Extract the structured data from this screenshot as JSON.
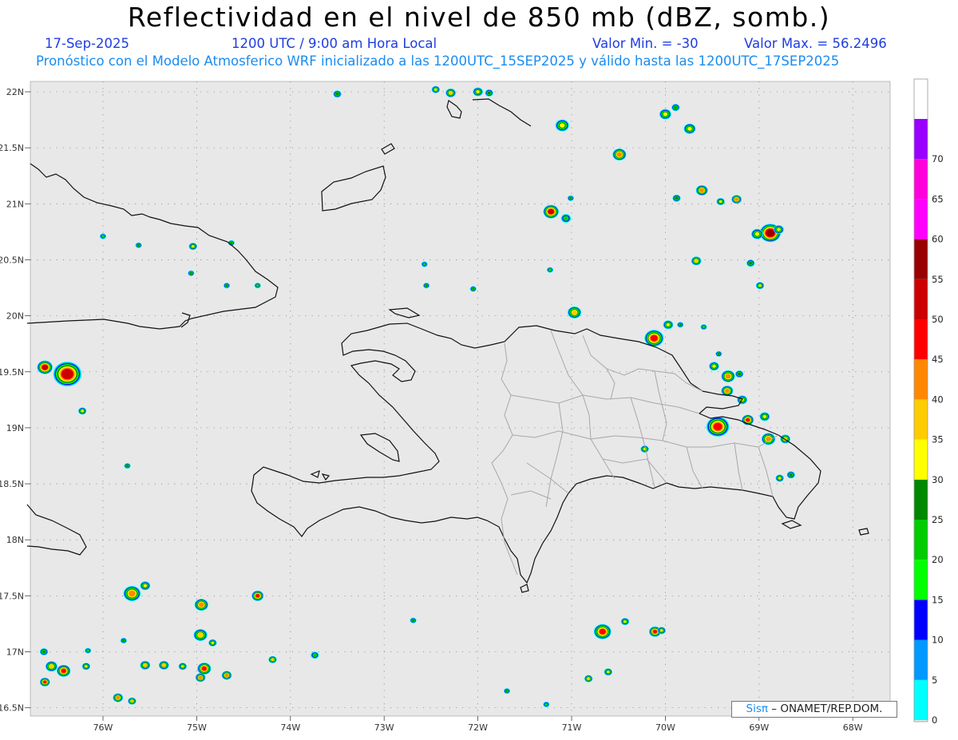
{
  "header": {
    "title": "Reflectividad en el nivel de 850 mb (dBZ, somb.)",
    "date": "17-Sep-2025",
    "time": "1200 UTC / 9:00 am Hora Local",
    "min_value": "Valor Min. = -30",
    "max_value": "Valor Max. = 56.2496",
    "forecast_info": "Pronóstico con el Modelo Atmosferico WRF inicializado a las 1200UTC_15SEP2025 y válido hasta las  1200UTC_17SEP2025"
  },
  "axes": {
    "lat_labels": [
      "22N",
      "21.5N",
      "21N",
      "20.5N",
      "20N",
      "19.5N",
      "19N",
      "18.5N",
      "18N",
      "17.5N",
      "17N",
      "16.5N"
    ],
    "lon_labels": [
      "76W",
      "75W",
      "74W",
      "73W",
      "72W",
      "71W",
      "70W",
      "69W",
      "68W"
    ]
  },
  "colorbar": {
    "levels": [
      0,
      5,
      10,
      15,
      20,
      25,
      30,
      35,
      40,
      45,
      50,
      55,
      60,
      65,
      70
    ],
    "colors": [
      "#00ffff",
      "#0099ff",
      "#0000ff",
      "#00ff00",
      "#00cc00",
      "#008800",
      "#ffff00",
      "#ffcc00",
      "#ff8800",
      "#ff0000",
      "#cc0000",
      "#990000",
      "#ff00ff",
      "#ff00dd",
      "#9900ff"
    ],
    "labels": [
      "0",
      "5",
      "10",
      "15",
      "20",
      "25",
      "30",
      "35",
      "40",
      "45",
      "50",
      "55",
      "60",
      "65",
      "70"
    ]
  },
  "credit": {
    "logo": "Sisπ",
    "text": " – ONAMET/REP.DOM."
  },
  "echoes": [
    {
      "lon": -72.45,
      "lat": 22.02,
      "r": 3,
      "max": 30
    },
    {
      "lon": -72.29,
      "lat": 21.99,
      "r": 4,
      "max": 35
    },
    {
      "lon": -72.0,
      "lat": 22.0,
      "r": 4,
      "max": 30
    },
    {
      "lon": -71.88,
      "lat": 21.99,
      "r": 3,
      "max": 25
    },
    {
      "lon": -73.5,
      "lat": 21.98,
      "r": 3,
      "max": 25
    },
    {
      "lon": -71.1,
      "lat": 21.7,
      "r": 6,
      "max": 30
    },
    {
      "lon": -70.49,
      "lat": 21.44,
      "r": 6,
      "max": 40
    },
    {
      "lon": -70.0,
      "lat": 21.8,
      "r": 5,
      "max": 30
    },
    {
      "lon": -69.89,
      "lat": 21.86,
      "r": 3,
      "max": 25
    },
    {
      "lon": -69.74,
      "lat": 21.67,
      "r": 5,
      "max": 30
    },
    {
      "lon": -69.88,
      "lat": 21.05,
      "r": 3,
      "max": 25
    },
    {
      "lon": -69.61,
      "lat": 21.12,
      "r": 5,
      "max": 40
    },
    {
      "lon": -69.41,
      "lat": 21.02,
      "r": 3,
      "max": 30
    },
    {
      "lon": -69.24,
      "lat": 21.04,
      "r": 4,
      "max": 40
    },
    {
      "lon": -71.22,
      "lat": 20.93,
      "r": 7,
      "max": 50
    },
    {
      "lon": -71.06,
      "lat": 20.87,
      "r": 4,
      "max": 20
    },
    {
      "lon": -71.01,
      "lat": 21.05,
      "r": 2,
      "max": 25
    },
    {
      "lon": -68.88,
      "lat": 20.74,
      "r": 10,
      "max": 55
    },
    {
      "lon": -69.02,
      "lat": 20.73,
      "r": 5,
      "max": 30
    },
    {
      "lon": -68.79,
      "lat": 20.77,
      "r": 4,
      "max": 30
    },
    {
      "lon": -69.67,
      "lat": 20.49,
      "r": 4,
      "max": 35
    },
    {
      "lon": -69.09,
      "lat": 20.47,
      "r": 3,
      "max": 25
    },
    {
      "lon": -68.99,
      "lat": 20.27,
      "r": 3,
      "max": 30
    },
    {
      "lon": -70.97,
      "lat": 20.03,
      "r": 6,
      "max": 35
    },
    {
      "lon": -70.12,
      "lat": 19.8,
      "r": 9,
      "max": 45
    },
    {
      "lon": -69.97,
      "lat": 19.92,
      "r": 4,
      "max": 30
    },
    {
      "lon": -69.84,
      "lat": 19.92,
      "r": 2,
      "max": 25
    },
    {
      "lon": -69.59,
      "lat": 19.9,
      "r": 2,
      "max": 20
    },
    {
      "lon": -69.48,
      "lat": 19.55,
      "r": 4,
      "max": 30
    },
    {
      "lon": -69.33,
      "lat": 19.46,
      "r": 6,
      "max": 40
    },
    {
      "lon": -69.21,
      "lat": 19.48,
      "r": 3,
      "max": 25
    },
    {
      "lon": -69.34,
      "lat": 19.33,
      "r": 5,
      "max": 40
    },
    {
      "lon": -69.18,
      "lat": 19.25,
      "r": 4,
      "max": 30
    },
    {
      "lon": -69.44,
      "lat": 19.01,
      "r": 11,
      "max": 45
    },
    {
      "lon": -69.12,
      "lat": 19.07,
      "r": 5,
      "max": 45
    },
    {
      "lon": -68.94,
      "lat": 19.1,
      "r": 4,
      "max": 30
    },
    {
      "lon": -68.9,
      "lat": 18.9,
      "r": 6,
      "max": 40
    },
    {
      "lon": -68.72,
      "lat": 18.9,
      "r": 4,
      "max": 35
    },
    {
      "lon": -68.78,
      "lat": 18.55,
      "r": 3,
      "max": 30
    },
    {
      "lon": -68.66,
      "lat": 18.58,
      "r": 3,
      "max": 25
    },
    {
      "lon": -70.22,
      "lat": 18.81,
      "r": 3,
      "max": 30
    },
    {
      "lon": -76.38,
      "lat": 19.48,
      "r": 14,
      "max": 50
    },
    {
      "lon": -76.62,
      "lat": 19.54,
      "r": 7,
      "max": 50
    },
    {
      "lon": -76.22,
      "lat": 19.15,
      "r": 3,
      "max": 30
    },
    {
      "lon": -75.74,
      "lat": 18.66,
      "r": 2,
      "max": 25
    },
    {
      "lon": -75.69,
      "lat": 17.52,
      "r": 8,
      "max": 40
    },
    {
      "lon": -75.55,
      "lat": 17.59,
      "r": 4,
      "max": 30
    },
    {
      "lon": -74.95,
      "lat": 17.42,
      "r": 6,
      "max": 40
    },
    {
      "lon": -74.35,
      "lat": 17.5,
      "r": 5,
      "max": 45
    },
    {
      "lon": -74.96,
      "lat": 17.15,
      "r": 6,
      "max": 35
    },
    {
      "lon": -74.83,
      "lat": 17.08,
      "r": 3,
      "max": 30
    },
    {
      "lon": -74.19,
      "lat": 16.93,
      "r": 3,
      "max": 35
    },
    {
      "lon": -73.74,
      "lat": 16.97,
      "r": 3,
      "max": 20
    },
    {
      "lon": -74.92,
      "lat": 16.85,
      "r": 6,
      "max": 45
    },
    {
      "lon": -74.96,
      "lat": 16.77,
      "r": 4,
      "max": 40
    },
    {
      "lon": -74.68,
      "lat": 16.79,
      "r": 4,
      "max": 40
    },
    {
      "lon": -75.35,
      "lat": 16.88,
      "r": 4,
      "max": 35
    },
    {
      "lon": -75.55,
      "lat": 16.88,
      "r": 4,
      "max": 35
    },
    {
      "lon": -75.15,
      "lat": 16.87,
      "r": 3,
      "max": 30
    },
    {
      "lon": -76.18,
      "lat": 16.87,
      "r": 3,
      "max": 30
    },
    {
      "lon": -76.42,
      "lat": 16.83,
      "r": 6,
      "max": 45
    },
    {
      "lon": -76.55,
      "lat": 16.87,
      "r": 5,
      "max": 35
    },
    {
      "lon": -76.62,
      "lat": 16.73,
      "r": 4,
      "max": 45
    },
    {
      "lon": -76.63,
      "lat": 17.0,
      "r": 3,
      "max": 25
    },
    {
      "lon": -75.78,
      "lat": 17.1,
      "r": 2,
      "max": 25
    },
    {
      "lon": -76.16,
      "lat": 17.01,
      "r": 2,
      "max": 20
    },
    {
      "lon": -75.84,
      "lat": 16.59,
      "r": 4,
      "max": 40
    },
    {
      "lon": -75.69,
      "lat": 16.56,
      "r": 3,
      "max": 35
    },
    {
      "lon": -72.69,
      "lat": 17.28,
      "r": 2,
      "max": 25
    },
    {
      "lon": -71.69,
      "lat": 16.65,
      "r": 2,
      "max": 25
    },
    {
      "lon": -71.27,
      "lat": 16.53,
      "r": 2,
      "max": 20
    },
    {
      "lon": -70.67,
      "lat": 17.18,
      "r": 8,
      "max": 45
    },
    {
      "lon": -70.43,
      "lat": 17.27,
      "r": 3,
      "max": 30
    },
    {
      "lon": -70.11,
      "lat": 17.18,
      "r": 5,
      "max": 45
    },
    {
      "lon": -70.04,
      "lat": 17.19,
      "r": 3,
      "max": 30
    },
    {
      "lon": -70.82,
      "lat": 16.76,
      "r": 3,
      "max": 35
    },
    {
      "lon": -70.61,
      "lat": 16.82,
      "r": 3,
      "max": 30
    },
    {
      "lon": -75.62,
      "lat": 20.63,
      "r": 2,
      "max": 25
    },
    {
      "lon": -75.04,
      "lat": 20.62,
      "r": 3,
      "max": 30
    },
    {
      "lon": -74.63,
      "lat": 20.65,
      "r": 2,
      "max": 25
    },
    {
      "lon": -75.06,
      "lat": 20.38,
      "r": 2,
      "max": 25
    },
    {
      "lon": -74.68,
      "lat": 20.27,
      "r": 2,
      "max": 25
    },
    {
      "lon": -74.35,
      "lat": 20.27,
      "r": 2,
      "max": 20
    },
    {
      "lon": -76.0,
      "lat": 20.71,
      "r": 2,
      "max": 20
    },
    {
      "lon": -72.57,
      "lat": 20.46,
      "r": 2,
      "max": 20
    },
    {
      "lon": -72.55,
      "lat": 20.27,
      "r": 2,
      "max": 25
    },
    {
      "lon": -72.05,
      "lat": 20.24,
      "r": 2,
      "max": 25
    },
    {
      "lon": -71.23,
      "lat": 20.41,
      "r": 2,
      "max": 20
    },
    {
      "lon": -69.43,
      "lat": 19.66,
      "r": 2,
      "max": 25
    }
  ]
}
